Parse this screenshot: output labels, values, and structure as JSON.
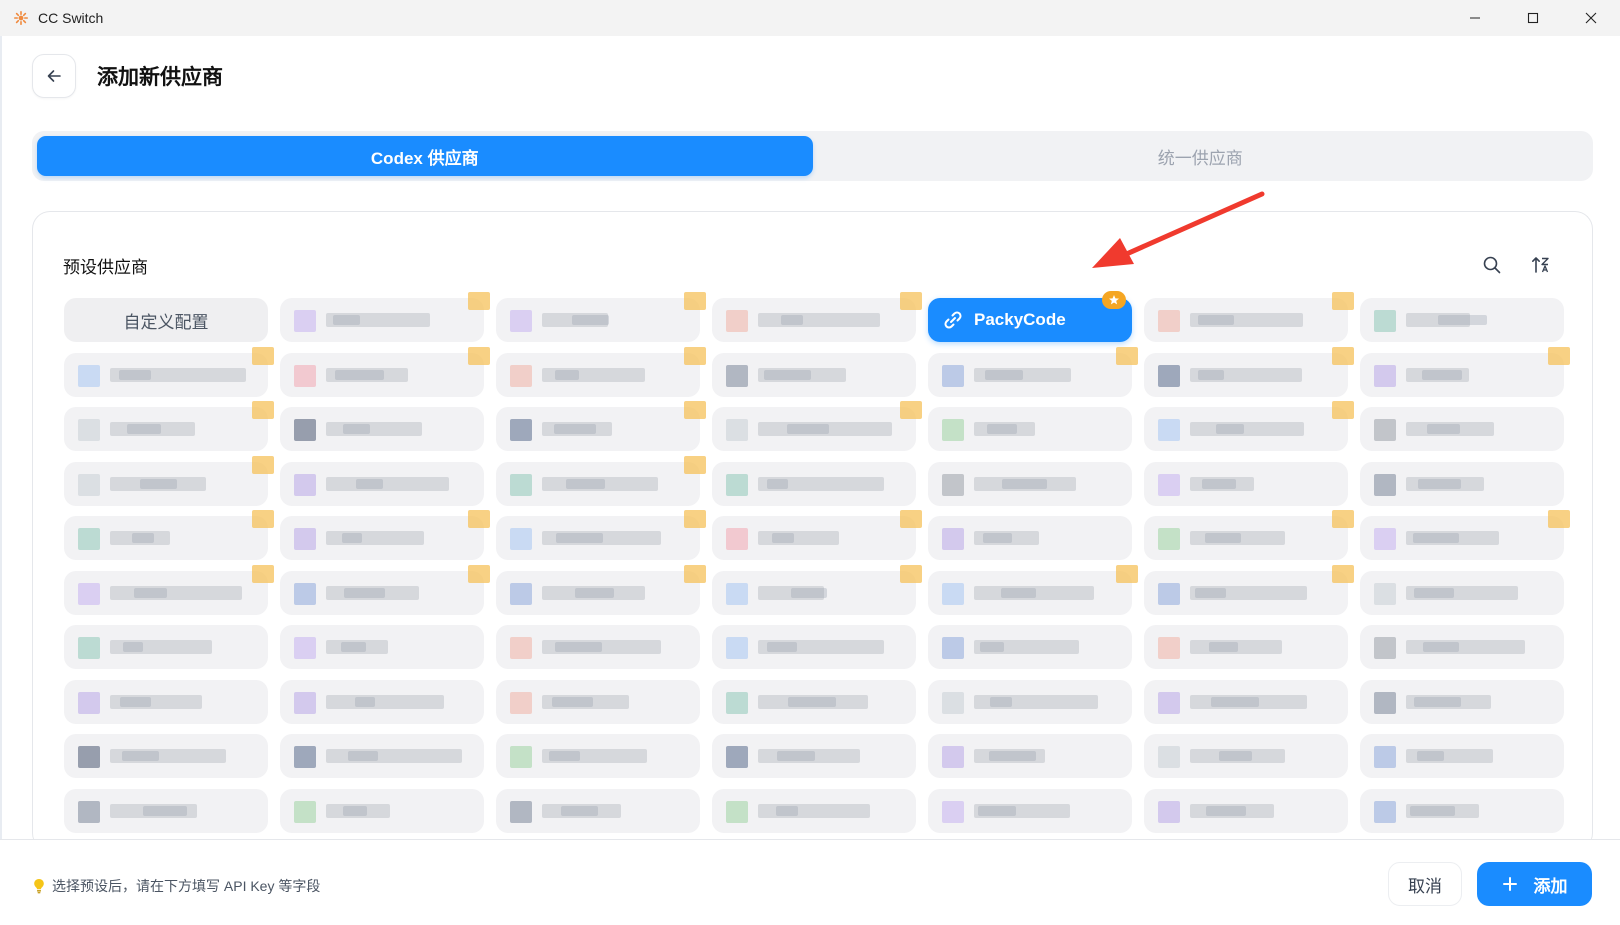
{
  "titlebar": {
    "app_title": "CC Switch"
  },
  "header": {
    "title": "添加新供应商"
  },
  "tabs": [
    {
      "label": "Codex 供应商",
      "active": true
    },
    {
      "label": "统一供应商",
      "active": false
    }
  ],
  "presets": {
    "label": "预设供应商",
    "custom_label": "自定义配置",
    "selected_label": "PackyCode",
    "selected_badge_icon": "star-icon"
  },
  "footer": {
    "hint": "选择预设后，请在下方填写 API Key 等字段",
    "cancel_label": "取消",
    "add_label": "添加"
  },
  "colors": {
    "accent": "#1a8cff",
    "badge": "#f5a623",
    "annotation_arrow": "#f03a2e"
  }
}
